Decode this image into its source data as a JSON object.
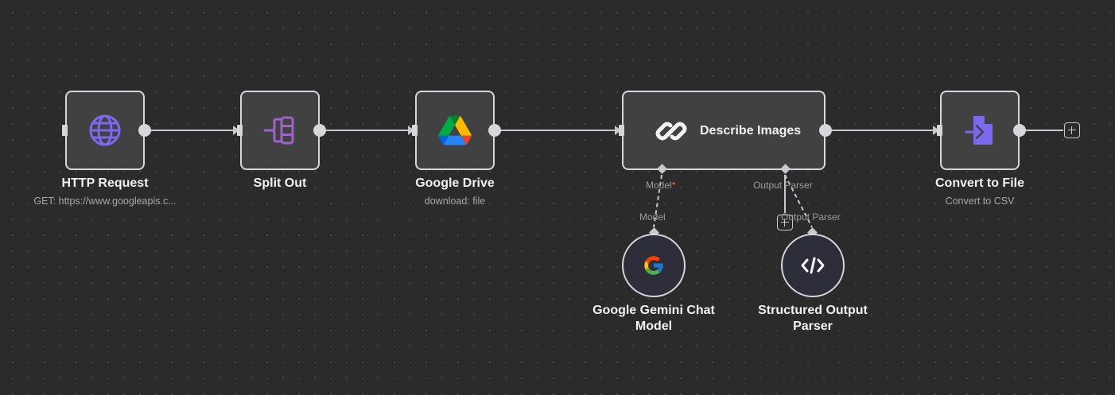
{
  "nodes": {
    "http_request": {
      "title": "HTTP Request",
      "subtitle": "GET: https://www.googleapis.c...",
      "icon": "globe-icon"
    },
    "split_out": {
      "title": "Split Out",
      "icon": "split-out-icon"
    },
    "google_drive": {
      "title": "Google Drive",
      "subtitle": "download: file",
      "icon": "google-drive-icon"
    },
    "describe_images": {
      "title": "Describe Images",
      "icon": "chain-link-icon"
    },
    "convert_to_file": {
      "title": "Convert to File",
      "subtitle": "Convert to CSV",
      "icon": "file-import-icon"
    },
    "gemini_chat_model": {
      "title": "Google Gemini Chat Model",
      "icon": "google-g-icon"
    },
    "structured_output_parser": {
      "title": "Structured Output Parser",
      "icon": "code-icon"
    }
  },
  "connectors": {
    "model_label": "Model",
    "model_required": "*",
    "output_parser_label": "Output Parser",
    "model_edge_label": "Model",
    "output_parser_edge_label": "Output Parser"
  },
  "colors": {
    "canvas": "#2b2b2b",
    "node_fill": "#414141",
    "node_border": "#d6d6db",
    "accent_purple": "#7c69ef",
    "split_out_purple": "#a064c8",
    "required": "#ff6d5a"
  }
}
